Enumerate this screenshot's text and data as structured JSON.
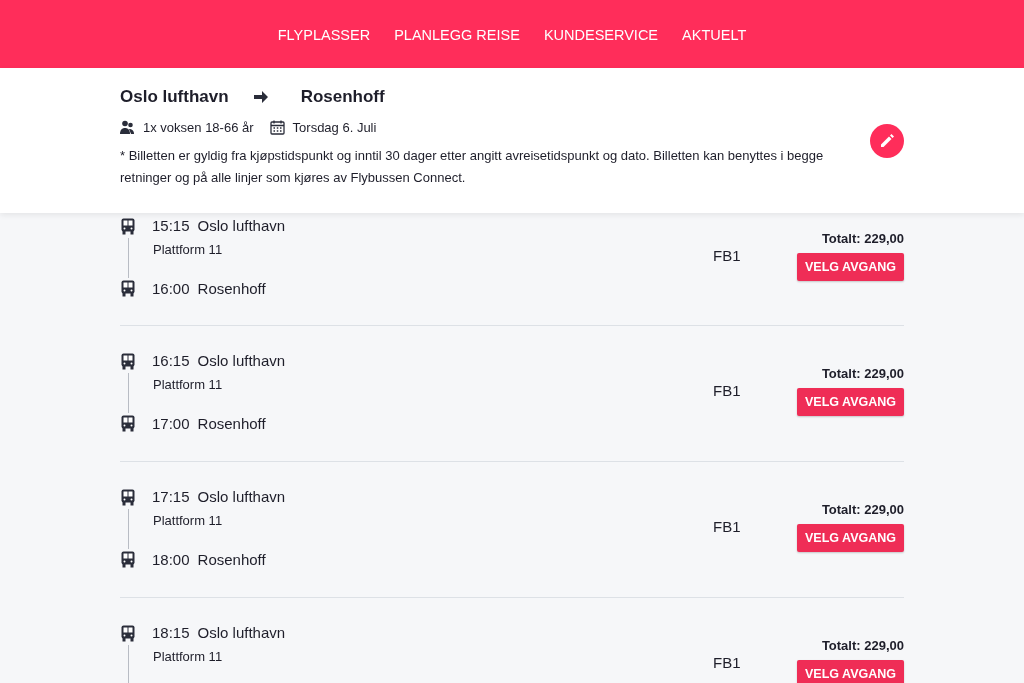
{
  "nav": [
    {
      "label": "FLYPLASSER"
    },
    {
      "label": "PLANLEGG REISE"
    },
    {
      "label": "KUNDESERVICE"
    },
    {
      "label": "AKTUELT"
    }
  ],
  "trip": {
    "from": "Oslo lufthavn",
    "to": "Rosenhoff",
    "passengers": "1x voksen 18-66 år",
    "date": "Torsdag 6. Juli",
    "note": "* Billetten er gyldig fra kjøpstidspunkt og inntil 30 dager etter angitt avreisetidspunkt og dato. Billetten kan benyttes i begge retninger og på alle linjer som kjøres av Flybussen Connect."
  },
  "departures": [
    {
      "departure_time": "15:15",
      "departure_stop": "Oslo lufthavn",
      "platform": "Plattform 11",
      "arrival_time": "16:00",
      "arrival_stop": "Rosenhoff",
      "route": "FB1",
      "total": "Totalt: 229,00",
      "button": "VELG AVGANG"
    },
    {
      "departure_time": "16:15",
      "departure_stop": "Oslo lufthavn",
      "platform": "Plattform 11",
      "arrival_time": "17:00",
      "arrival_stop": "Rosenhoff",
      "route": "FB1",
      "total": "Totalt: 229,00",
      "button": "VELG AVGANG"
    },
    {
      "departure_time": "17:15",
      "departure_stop": "Oslo lufthavn",
      "platform": "Plattform 11",
      "arrival_time": "18:00",
      "arrival_stop": "Rosenhoff",
      "route": "FB1",
      "total": "Totalt: 229,00",
      "button": "VELG AVGANG"
    },
    {
      "departure_time": "18:15",
      "departure_stop": "Oslo lufthavn",
      "platform": "Plattform 11",
      "route": "FB1",
      "total": "Totalt: 229,00",
      "button": "VELG AVGANG"
    }
  ]
}
